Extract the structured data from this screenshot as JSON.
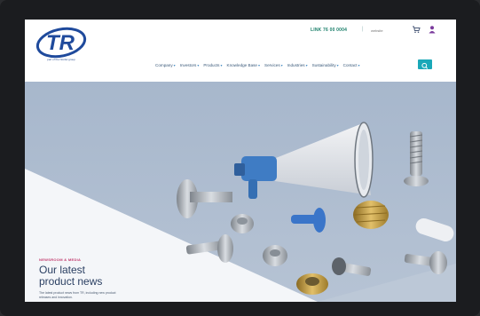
{
  "header": {
    "logo_tagline": "part of the Nordel group",
    "phone": "LINK 76 00 0004",
    "search_placeholder": "website"
  },
  "nav": {
    "items": [
      {
        "label": "Company"
      },
      {
        "label": "Investors"
      },
      {
        "label": "Products"
      },
      {
        "label": "Knowledge Base"
      },
      {
        "label": "Services"
      },
      {
        "label": "Industries"
      },
      {
        "label": "Sustainability"
      },
      {
        "label": "Contact"
      }
    ]
  },
  "hero": {
    "kicker": "NEWSROOM & MEDIA",
    "headline_line1": "Our latest",
    "headline_line2": "product news",
    "subtext": "The latest product news from TR, including new product releases and innovation."
  },
  "colors": {
    "brand_blue": "#1f4a9c",
    "accent_teal": "#1aa8b8",
    "kicker_pink": "#c23a6d",
    "hero_bg": "#a9b9cd"
  },
  "icons": [
    "cart-icon",
    "user-icon",
    "search-icon",
    "chevron-down-icon"
  ]
}
